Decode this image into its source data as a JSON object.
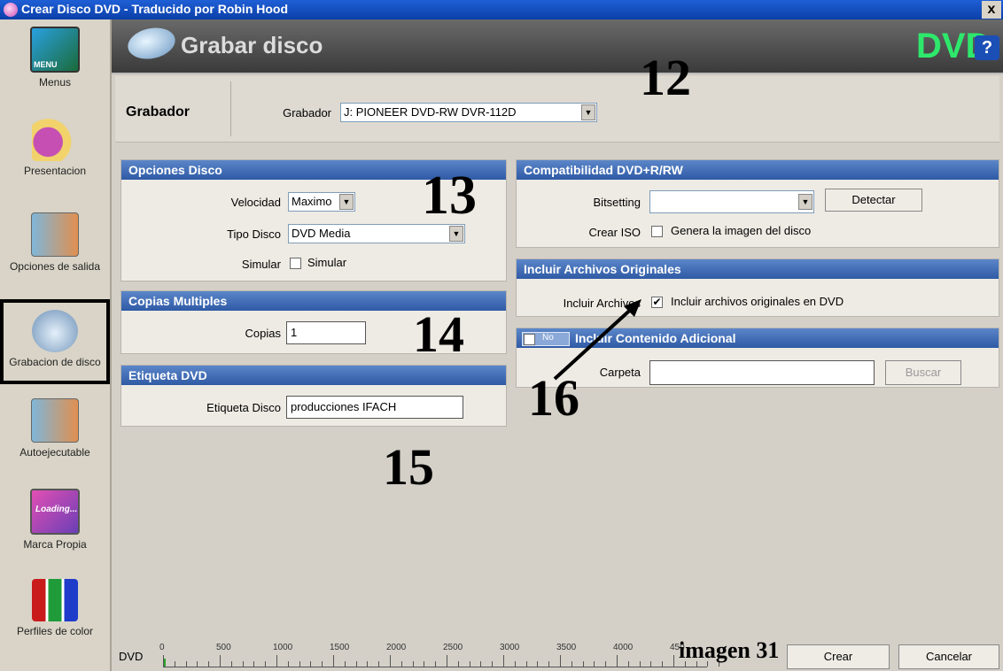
{
  "window": {
    "title": "Crear Disco DVD - Traducido por Robin Hood",
    "close_label": "x"
  },
  "sidebar": {
    "items": [
      {
        "label": "Menus",
        "badge": "MENU"
      },
      {
        "label": "Presentacion"
      },
      {
        "label": "Opciones de salida"
      },
      {
        "label": "Grabacion de disco",
        "selected": true
      },
      {
        "label": "Autoejecutable"
      },
      {
        "label": "Marca Propia",
        "badge": "Loading..."
      },
      {
        "label": "Perfiles de color"
      }
    ]
  },
  "header": {
    "title": "Grabar disco",
    "brand": "DVD",
    "help": "?"
  },
  "recorder": {
    "section_label": "Grabador",
    "field_label": "Grabador",
    "value": "J: PIONEER DVD-RW  DVR-112D"
  },
  "opciones_disco": {
    "title": "Opciones Disco",
    "velocidad_label": "Velocidad",
    "velocidad_value": "Maximo",
    "tipo_label": "Tipo Disco",
    "tipo_value": "DVD Media",
    "simular_label": "Simular",
    "simular_check_label": "Simular"
  },
  "copias": {
    "title": "Copias Multiples",
    "label": "Copias",
    "value": "1"
  },
  "etiqueta": {
    "title": "Etiqueta DVD",
    "label": "Etiqueta Disco",
    "value": "producciones IFACH"
  },
  "compat": {
    "title": "Compatibilidad DVD+R/RW",
    "bitsetting_label": "Bitsetting",
    "bitsetting_value": "",
    "detect_label": "Detectar",
    "iso_label": "Crear ISO",
    "iso_check_label": "Genera la imagen del disco"
  },
  "originales": {
    "title": "Incluir Archivos Originales",
    "label": "Incluir Archivos",
    "check_label": "Incluir archivos originales en DVD",
    "checked_mark": "✔"
  },
  "adicional": {
    "title": "Incluir Contenido Adicional",
    "toggle": "No",
    "folder_label": "Carpeta",
    "folder_value": "",
    "browse_label": "Buscar"
  },
  "annotations": {
    "a12": "12",
    "a13": "13",
    "a14": "14",
    "a15": "15",
    "a16": "16",
    "caption": "imagen 31"
  },
  "capacity": {
    "label": "DVD",
    "ticks": [
      "0",
      "500",
      "1000",
      "1500",
      "2000",
      "2500",
      "3000",
      "3500",
      "4000",
      "450"
    ]
  },
  "actions": {
    "create": "Crear",
    "cancel": "Cancelar"
  }
}
